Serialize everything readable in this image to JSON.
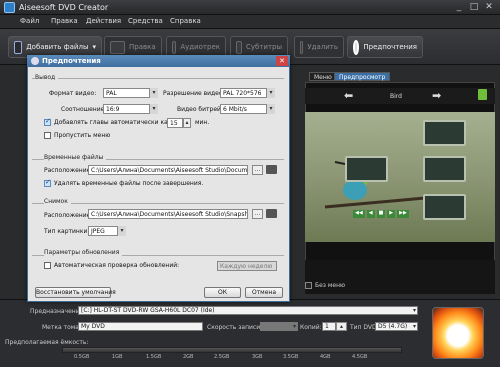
{
  "window": {
    "title": "Aiseesoft DVD Creator",
    "minimize": "_",
    "maximize": "□",
    "close": "✕"
  },
  "menu": [
    "Файл",
    "Правка",
    "Действия",
    "Средства",
    "Справка"
  ],
  "toolbar": {
    "add_files": "Добавить файлы",
    "edit": "Правка",
    "audio": "Аудиотрек",
    "subtitles": "Субтитры",
    "delete": "Удалить",
    "preferences": "Предпочтения"
  },
  "preview": {
    "tab_menu": "Меню",
    "tab_preview": "Предпросмотр",
    "nav_title": "Bird",
    "no_menu_label": "Без меню",
    "controls": [
      "◀◀",
      "◀",
      "■",
      "▶",
      "▶▶"
    ]
  },
  "dialog": {
    "title": "Предпочтения",
    "output": {
      "section": "Вывод",
      "video_format_label": "Формат видео:",
      "video_format": "PAL",
      "resolution_label": "Разрешение видео:",
      "resolution": "PAL 720*576",
      "aspect_label": "Соотношение:",
      "aspect": "16:9",
      "bitrate_label": "Видео битрейт:",
      "bitrate": "6 Mbit/s",
      "add_chapters_label": "Добавлять главы автоматически каждые",
      "add_chapters_checked": true,
      "chapter_minutes": "15",
      "minutes_unit": "мин.",
      "skip_menu_label": "Пропустить меню",
      "skip_menu_checked": false
    },
    "temp": {
      "section": "Временные файлы",
      "location_label": "Расположение:",
      "location": "C:\\Users\\Алина\\Documents\\Aiseesoft Studio\\Document",
      "delete_after_label": "Удалять временные файлы после завершения.",
      "delete_after_checked": true
    },
    "snapshot": {
      "section": "Снимок",
      "location_label": "Расположение:",
      "location": "C:\\Users\\Алина\\Documents\\Aiseesoft Studio\\Snapshot",
      "type_label": "Тип картинки:",
      "type": "JPEG"
    },
    "updates": {
      "section": "Параметры обновления",
      "auto_check_label": "Автоматическая проверка обновлений:",
      "auto_check_checked": false,
      "interval": "Каждую неделю"
    },
    "restore_button": "Восстановить умолчания",
    "ok_button": "ОК",
    "cancel_button": "Отмена",
    "browse_dots": "...",
    "folder_icon_alt": "📁"
  },
  "bottom": {
    "destination_label": "Предназначение:",
    "destination": "[C:] HL-DT-ST DVD-RW GSA-H60L DC07 (Ide)",
    "volume_label_label": "Метка тома:",
    "volume_label": "My DVD",
    "speed_label": "Скорость записи:",
    "copies_label": "Копий:",
    "copies": "1",
    "disc_type_label": "Тип DVD:",
    "disc_type": "D5 (4.7G)",
    "capacity_label": "Предполагаемая ёмкость:",
    "capacity_ticks": [
      "0.5GB",
      "1GB",
      "1.5GB",
      "2GB",
      "2.5GB",
      "3GB",
      "3.5GB",
      "4GB",
      "4.5GB"
    ]
  }
}
